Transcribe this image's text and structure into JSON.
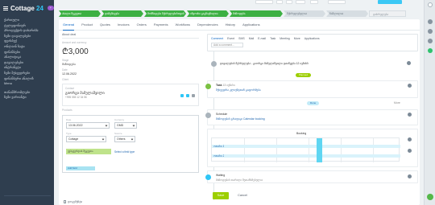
{
  "sidebar": {
    "logo": "Cottage",
    "logo_suffix": "24",
    "new_button": "+",
    "items": [
      "ქართული",
      "ტელეფონიურ",
      "პროდუქტის დახარისხ",
      "ჩემი დავალებები",
      "ფეისბუქ",
      "ონლაინ ჩატი",
      "ფინანსები",
      "ანალიტიკა",
      "დავალებები",
      "ინტრანეტი",
      "ჩემი შეხვედრები",
      "ფინანსური ანალიზ",
      "Menu"
    ],
    "items_lower": [
      "თანამშრომლები",
      "ჩემი ვარიანტი"
    ]
  },
  "stages": [
    {
      "label": "ახალი შეკვეთა",
      "state": "done"
    },
    {
      "label": "დამუშავება",
      "state": "done"
    },
    {
      "label": "მომზადება შესრულებისთვის",
      "state": "done"
    },
    {
      "label": "ინვოისი გაგზავნილია",
      "state": "done"
    },
    {
      "label": "მიწოდება",
      "state": "done"
    },
    {
      "label": "შესრულებულია",
      "state": "todo"
    },
    {
      "label": "ჩაშლილია",
      "state": "todo"
    },
    {
      "label": "დასრულება",
      "state": "lost"
    }
  ],
  "tabs": [
    "General",
    "Product",
    "Quotes",
    "Invoices",
    "Orders",
    "Payments",
    "Workflows",
    "Dependencies",
    "History",
    "Applications"
  ],
  "left": {
    "section_title": "About deal",
    "amount_label": "Amount and currency",
    "amount": "₾3,000",
    "stage_label": "Stage",
    "stage_value": "მიწოდება",
    "date_label": "Date",
    "date_value": "12.06.2022",
    "client_section": "Client",
    "client_label": "Contact",
    "client_name": "გიორგი მამულაშვილი",
    "client_phone": "+995 555 12 34 56",
    "form_section": "Products",
    "field_date_label": "Date",
    "field_date_value": "13.06.2022",
    "field_currency_label": "Currency",
    "field_currency_value": "GMD",
    "field_type_label": "Type",
    "field_type_value": "Cottage",
    "field_source_label": "Source",
    "field_source_value": "Others",
    "chip_text": "ვებგვერდის შეკვეთა",
    "chip_link": "Select a field type",
    "teal_chip": "Add field",
    "bottom_item": "დოკუმენტი"
  },
  "timeline": {
    "editor_tabs": [
      "Comment",
      "Event",
      "SMS",
      "Mail",
      "E-mail",
      "Task",
      "Meeting",
      "More",
      "Applications"
    ],
    "editor_placeholder": "Add a comment...",
    "item1_text": "დავალების შესრულება - გიორგი მამულაშვილი დაიწყება 12 ივნისს",
    "pill_green": "Planned",
    "item2_title": "Task",
    "item2_date": "13 ივნისი",
    "item2_text": "შეხვედრა კლიენტთან გაფორმება",
    "pill_blue": "Done",
    "item2_right": "More",
    "item3_title": "Schedule",
    "item3_text": "მიწოდების გრაფიკი Calendar booking",
    "sched_label": "Booking",
    "sched_rows": [
      "ოთახი 1",
      "ოთახი 2"
    ],
    "item4_title": "Waiting",
    "item4_text": "მიწოდების თარიღი შეთანხმებულია"
  },
  "actions": {
    "save": "Save",
    "cancel": "Cancel"
  },
  "colors": {
    "sidebar_bg": "#2f3e4f",
    "stage_done": "#3cb043",
    "accent_blue": "#0b66c3",
    "save_green": "#9dcf00"
  }
}
